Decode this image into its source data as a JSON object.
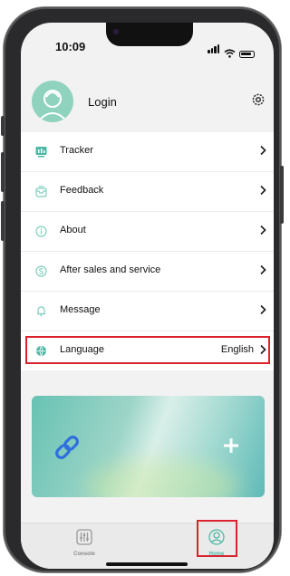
{
  "status_bar": {
    "time": "10:09"
  },
  "header": {
    "login_label": "Login",
    "settings_icon": "gear-icon",
    "avatar_icon": "user-avatar-icon"
  },
  "menu": {
    "items": [
      {
        "label": "Tracker",
        "icon": "tracker-icon",
        "value": ""
      },
      {
        "label": "Feedback",
        "icon": "feedback-icon",
        "value": ""
      },
      {
        "label": "About",
        "icon": "info-icon",
        "value": ""
      },
      {
        "label": "After sales and service",
        "icon": "service-icon",
        "value": ""
      },
      {
        "label": "Message",
        "icon": "bell-icon",
        "value": ""
      },
      {
        "label": "Language",
        "icon": "globe-icon",
        "value": "English"
      }
    ]
  },
  "banner": {
    "link_icon": "link-icon",
    "add_icon": "plus-icon"
  },
  "tabbar": {
    "tabs": [
      {
        "label": "Console",
        "icon": "console-sliders-icon",
        "active": false
      },
      {
        "label": "Home",
        "icon": "home-user-icon",
        "active": true
      }
    ]
  },
  "colors": {
    "accent": "#8fd3bf",
    "highlight": "#d9232e",
    "icon_teal": "#4eb8a5"
  }
}
